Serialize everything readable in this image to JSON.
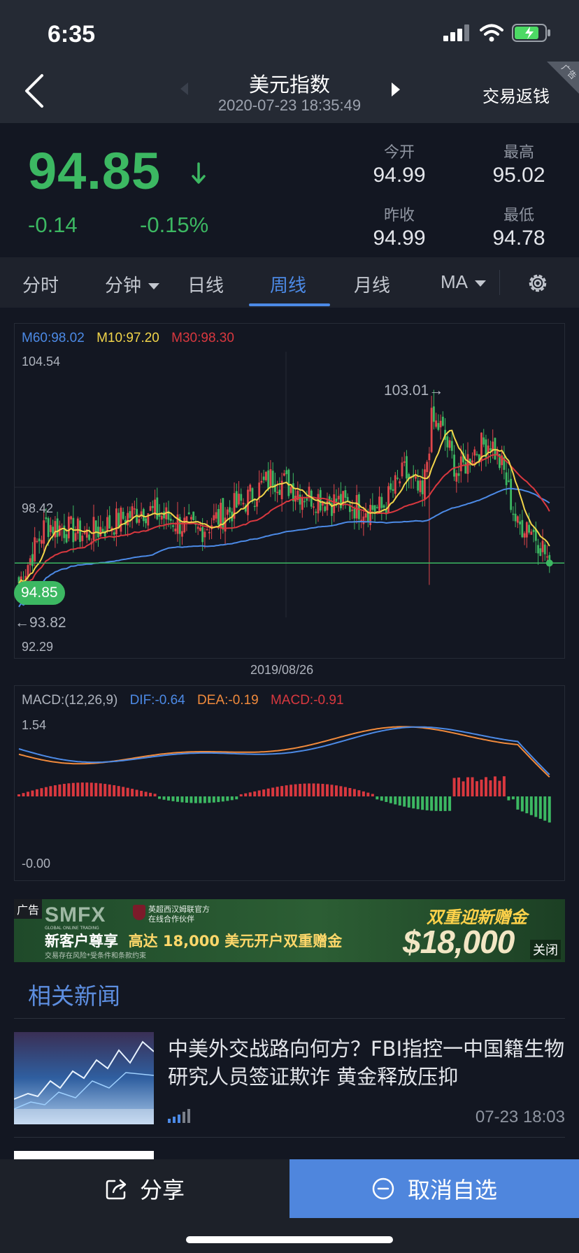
{
  "status_bar": {
    "time": "6:35"
  },
  "nav": {
    "title": "美元指数",
    "datetime": "2020-07-23 18:35:49",
    "right_link": "交易返钱",
    "corner_tag": "广告"
  },
  "quote": {
    "price": "94.85",
    "change": "-0.14",
    "change_pct": "-0.15%",
    "stats": [
      {
        "label": "今开",
        "value": "94.99"
      },
      {
        "label": "最高",
        "value": "95.02"
      },
      {
        "label": "昨收",
        "value": "94.99"
      },
      {
        "label": "最低",
        "value": "94.78"
      }
    ],
    "colors": {
      "down": "#3cb862",
      "up": "#e0464b"
    }
  },
  "tabs": {
    "items": [
      "分时",
      "分钟",
      "日线",
      "周线",
      "月线",
      "MA"
    ],
    "active": "周线"
  },
  "main_chart": {
    "legend": {
      "m60": "M60:98.02",
      "m10": "M10:97.20",
      "m30": "M30:98.30"
    },
    "y_top": "104.54",
    "y_mid": "98.42",
    "y_bottom": "92.29",
    "current_price": "94.85",
    "max_marker": "103.01→",
    "min_marker": "←93.82",
    "date_label": "2019/08/26",
    "colors": {
      "m60": "#4c8ae6",
      "m10": "#f2d54a",
      "m30": "#d9383f",
      "up": "#e0464b",
      "down": "#3cb862"
    }
  },
  "macd_chart": {
    "legend": {
      "params": "MACD:(12,26,9)",
      "dif": "DIF:-0.64",
      "dea": "DEA:-0.19",
      "macd": "MACD:-0.91"
    },
    "y_top": "1.54",
    "y_bottom": "-0.00",
    "colors": {
      "dif": "#4c8ae6",
      "dea": "#f08a3c",
      "macd": "#d9383f"
    }
  },
  "ad": {
    "tag": "广告",
    "logo": "SMFX",
    "logo_sub": "GLOBAL ONLINE TRADING",
    "partner_line1": "英超西汉姆联官方",
    "partner_line2": "在线合作伙伴",
    "headline_a": "新客户尊享",
    "headline_b": "高达 18,000 美元开户双重赠金",
    "fine_print": "交易存在风险*受条件和条款约束",
    "promo_title": "双重迎新赠金",
    "promo_amount": "$18,000",
    "close": "关闭"
  },
  "news": {
    "heading": "相关新闻",
    "items": [
      {
        "title": "中美外交战路向何方？FBI指控一中国籍生物研究人员签证欺诈 黄金释放压抑",
        "time": "07-23 18:03"
      }
    ]
  },
  "bottom_bar": {
    "share": "分享",
    "unfavorite": "取消自选"
  }
}
